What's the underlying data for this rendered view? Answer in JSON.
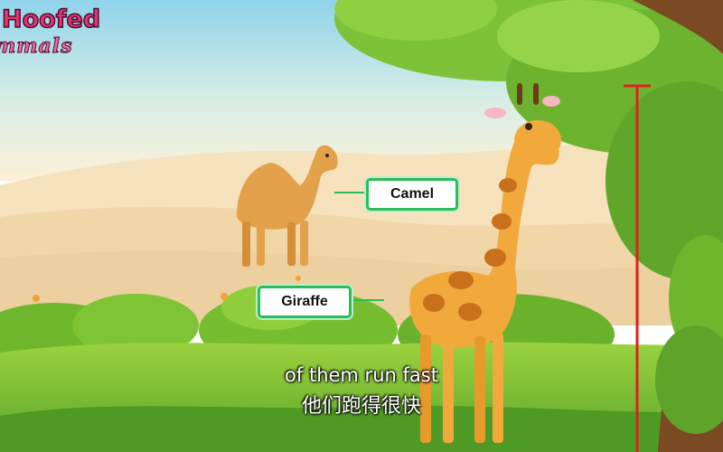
{
  "logo": {
    "line1": "Hoofed",
    "line2": "mmals"
  },
  "labels": {
    "camel": "Camel",
    "giraffe": "Giraffe"
  },
  "subtitles": {
    "english": "of them run fast",
    "chinese": "他们跑得很快"
  },
  "colors": {
    "sky_top": "#8fd3ea",
    "sky_bottom": "#fbf1d8",
    "sand": "#f3dcb3",
    "grass": "#7cc234",
    "label_border": "#2bbd58",
    "height_marker": "#e0201f"
  }
}
